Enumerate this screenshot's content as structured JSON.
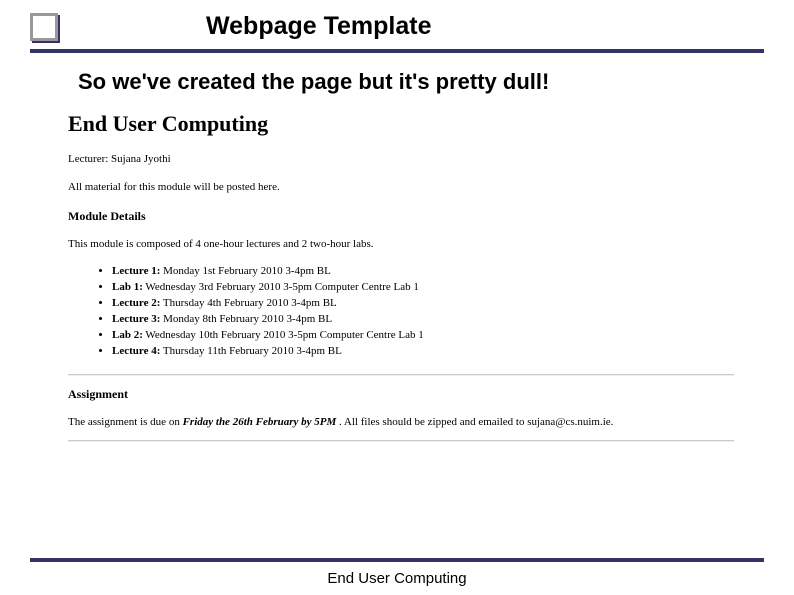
{
  "slide": {
    "title": "Webpage Template",
    "subtitle": "So we've created the page but it's pretty dull!"
  },
  "page": {
    "heading": "End User Computing",
    "lecturer": "Lecturer: Sujana Jyothi",
    "material": "All material for this module will be posted here.",
    "module_details_title": "Module Details",
    "module_details_desc": "This module is composed of 4 one-hour lectures and 2 two-hour labs.",
    "schedule": [
      {
        "label": "Lecture 1:",
        "text": " Monday 1st February 2010 3-4pm BL"
      },
      {
        "label": "Lab 1:",
        "text": " Wednesday 3rd February 2010 3-5pm Computer Centre Lab 1"
      },
      {
        "label": "Lecture 2:",
        "text": " Thursday 4th February 2010 3-4pm BL"
      },
      {
        "label": "Lecture 3:",
        "text": " Monday 8th February 2010 3-4pm BL"
      },
      {
        "label": "Lab 2:",
        "text": " Wednesday 10th February 2010 3-5pm Computer Centre Lab 1"
      },
      {
        "label": "Lecture 4:",
        "text": " Thursday 11th February 2010 3-4pm BL"
      }
    ],
    "assignment_title": "Assignment",
    "assignment_prefix": "The assignment is due on ",
    "assignment_due": "Friday the 26th February by 5PM",
    "assignment_suffix": " . All files should be zipped and emailed to sujana@cs.nuim.ie."
  },
  "footer": {
    "text": "End User Computing"
  }
}
